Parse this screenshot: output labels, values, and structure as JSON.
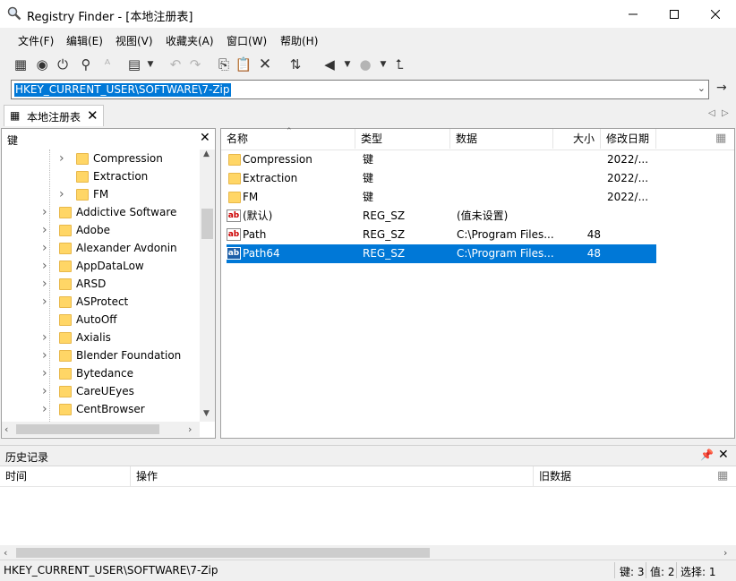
{
  "window": {
    "title": "Registry Finder - [本地注册表]"
  },
  "menu": [
    "文件(F)",
    "编辑(E)",
    "视图(V)",
    "收藏夹(A)",
    "窗口(W)",
    "帮助(H)"
  ],
  "address": {
    "value": "HKEY_CURRENT_USER\\SOFTWARE\\7-Zip"
  },
  "tab": {
    "label": "本地注册表"
  },
  "tree": {
    "header": "键",
    "items": [
      {
        "label": "Compression",
        "level": 2,
        "expander": true
      },
      {
        "label": "Extraction",
        "level": 2,
        "expander": false
      },
      {
        "label": "FM",
        "level": 2,
        "expander": true
      },
      {
        "label": "Addictive Software",
        "level": 1,
        "expander": true
      },
      {
        "label": "Adobe",
        "level": 1,
        "expander": true
      },
      {
        "label": "Alexander Avdonin",
        "level": 1,
        "expander": true
      },
      {
        "label": "AppDataLow",
        "level": 1,
        "expander": true
      },
      {
        "label": "ARSD",
        "level": 1,
        "expander": true
      },
      {
        "label": "ASProtect",
        "level": 1,
        "expander": true
      },
      {
        "label": "AutoOff",
        "level": 1,
        "expander": false
      },
      {
        "label": "Axialis",
        "level": 1,
        "expander": true
      },
      {
        "label": "Blender Foundation",
        "level": 1,
        "expander": true
      },
      {
        "label": "Bytedance",
        "level": 1,
        "expander": true
      },
      {
        "label": "CareUEyes",
        "level": 1,
        "expander": true
      },
      {
        "label": "CentBrowser",
        "level": 1,
        "expander": true
      }
    ]
  },
  "list": {
    "columns": [
      "名称",
      "类型",
      "数据",
      "大小",
      "修改日期"
    ],
    "rows": [
      {
        "icon": "folder",
        "name": "Compression",
        "type": "键",
        "data": "",
        "size": "",
        "date": "2022/..."
      },
      {
        "icon": "folder",
        "name": "Extraction",
        "type": "键",
        "data": "",
        "size": "",
        "date": "2022/..."
      },
      {
        "icon": "folder",
        "name": "FM",
        "type": "键",
        "data": "",
        "size": "",
        "date": "2022/..."
      },
      {
        "icon": "string-value",
        "name": "(默认)",
        "type": "REG_SZ",
        "data": "(值未设置)",
        "size": "",
        "date": ""
      },
      {
        "icon": "string-value",
        "name": "Path",
        "type": "REG_SZ",
        "data": "C:\\Program Files...",
        "size": "48",
        "date": ""
      },
      {
        "icon": "string-value",
        "name": "Path64",
        "type": "REG_SZ",
        "data": "C:\\Program Files...",
        "size": "48",
        "date": "",
        "selected": true
      }
    ]
  },
  "history": {
    "title": "历史记录",
    "columns": [
      "时间",
      "操作",
      "旧数据"
    ]
  },
  "status": {
    "path": "HKEY_CURRENT_USER\\SOFTWARE\\7-Zip",
    "keys": "键: 3",
    "values": "值: 2",
    "selected": "选择: 1"
  },
  "colors": {
    "selection": "#0078d7",
    "folder": "#ffd666"
  }
}
